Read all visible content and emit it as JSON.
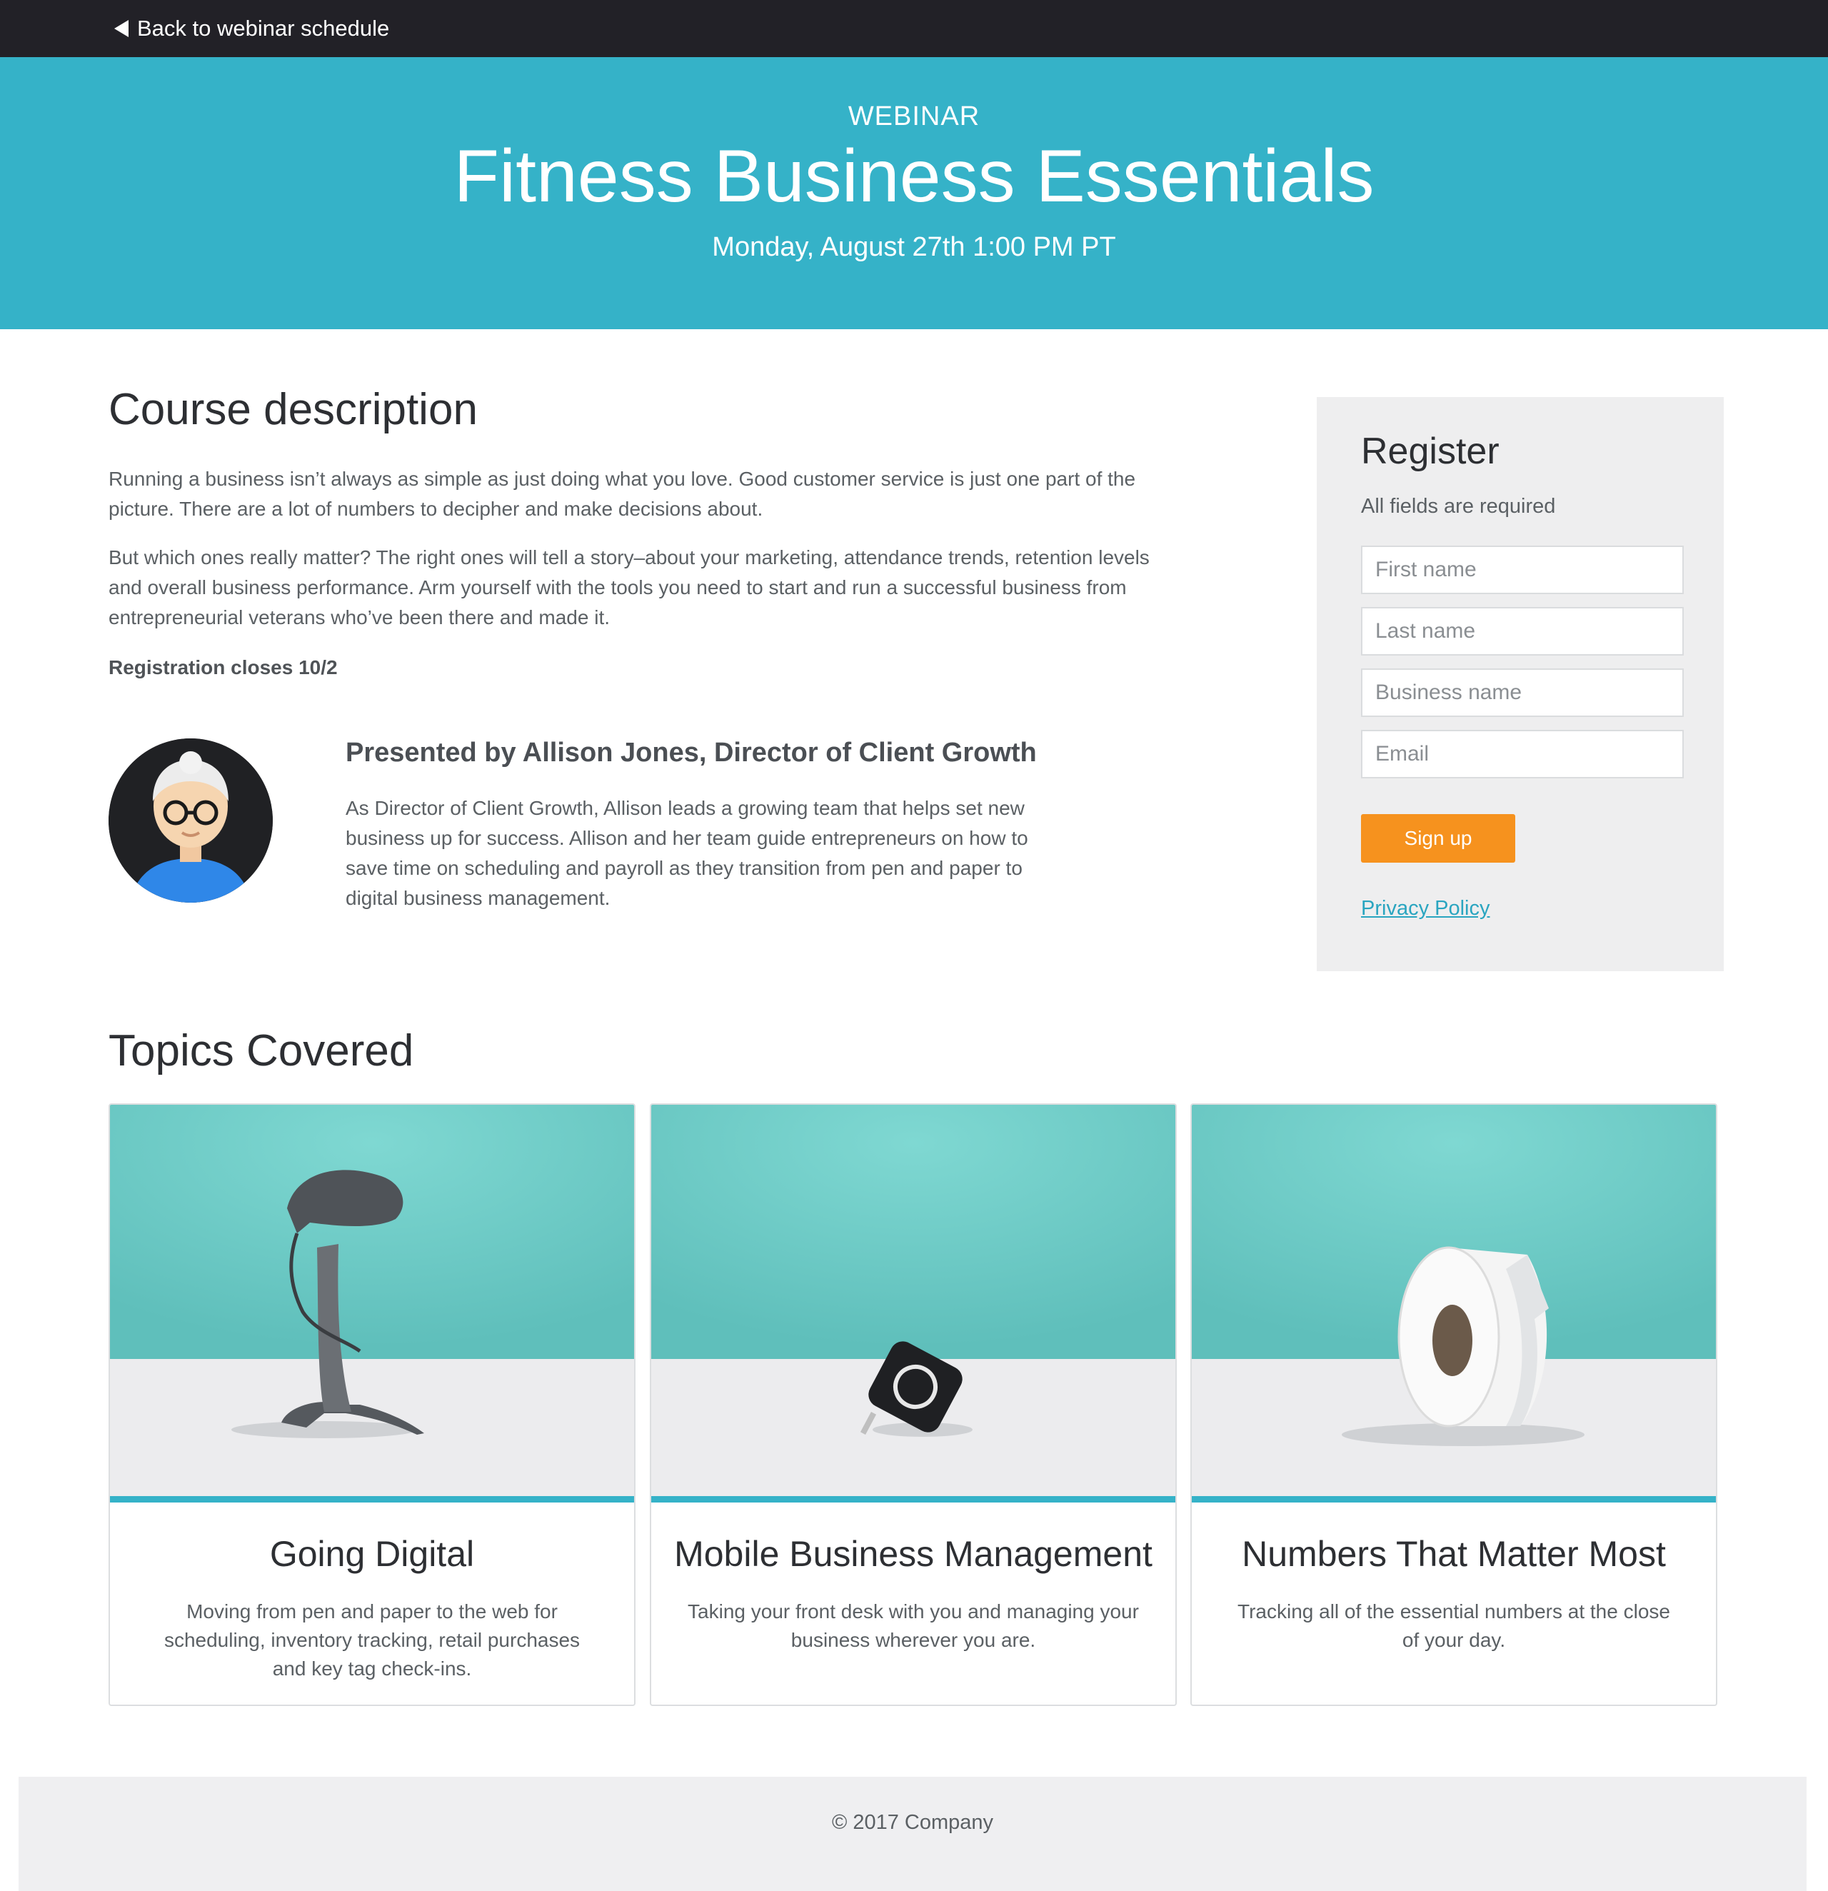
{
  "topbar": {
    "back_label": "Back to webinar schedule"
  },
  "hero": {
    "kicker": "WEBINAR",
    "title": "Fitness Business Essentials",
    "date": "Monday, August 27th 1:00 PM PT"
  },
  "course": {
    "heading": "Course description",
    "paragraphs": [
      "Running a business isn’t always as simple as just doing what you love. Good customer service is just one part of the picture. There are a lot of numbers to decipher and make decisions about.",
      "But which ones really matter? The right ones will tell a story–about your marketing, attendance trends, retention levels and overall business performance. Arm yourself with the tools you need to start and run a successful business from entrepreneurial veterans who’ve been there and made it."
    ],
    "registration_closes": "Registration closes 10/2"
  },
  "presenter": {
    "title": "Presented by Allison Jones, Director of Client Growth",
    "bio": "As Director of Client Growth, Allison leads a growing team that helps set new business up for success. Allison and her team guide entrepreneurs on how to save time on scheduling and payroll as they transition from pen and paper to digital business management."
  },
  "register": {
    "title": "Register",
    "note": "All fields are required",
    "fields": [
      {
        "placeholder": "First name"
      },
      {
        "placeholder": "Last name"
      },
      {
        "placeholder": "Business name"
      },
      {
        "placeholder": "Email"
      }
    ],
    "submit_label": "Sign up",
    "privacy_label": "Privacy Policy"
  },
  "topics": {
    "heading": "Topics Covered",
    "cards": [
      {
        "title": "Going Digital",
        "description": "Moving from pen and paper to the web for scheduling, inventory tracking, retail purchases and key tag check-ins.",
        "image_icon": "barcode-scanner-icon"
      },
      {
        "title": "Mobile Business Management",
        "description": "Taking your front desk with you and managing your business wherever you are.",
        "image_icon": "card-reader-icon"
      },
      {
        "title": "Numbers That Matter Most",
        "description": "Tracking all of the essential numbers at the close of your day.",
        "image_icon": "receipt-roll-icon"
      }
    ]
  },
  "footer": {
    "text": "© 2017 Company"
  },
  "colors": {
    "topbar": "#222127",
    "hero": "#35b2c8",
    "accent_orange": "#f6921e",
    "link": "#2aa5c0",
    "panel": "#eeeeef"
  }
}
